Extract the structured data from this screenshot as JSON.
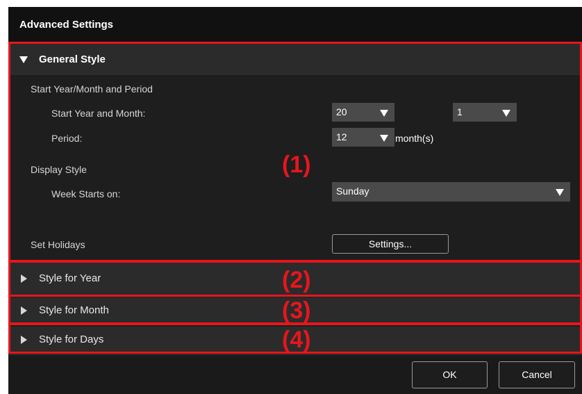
{
  "dialog": {
    "title": "Advanced Settings"
  },
  "general_style": {
    "header": "General Style",
    "start_group_label": "Start Year/Month and Period",
    "start_year_month_label": "Start Year and Month:",
    "start_year_value": "20",
    "start_month_value": "1",
    "period_label": "Period:",
    "period_value": "12",
    "period_unit": "month(s)",
    "display_style_label": "Display Style",
    "week_starts_label": "Week Starts on:",
    "week_starts_value": "Sunday",
    "set_holidays_label": "Set Holidays",
    "settings_button": "Settings..."
  },
  "sections": {
    "year": "Style for Year",
    "month": "Style for Month",
    "days": "Style for Days"
  },
  "annotations": {
    "label_1": "(1)",
    "label_2": "(2)",
    "label_3": "(3)",
    "label_4": "(4)"
  },
  "footer": {
    "ok_label": "OK",
    "cancel_label": "Cancel"
  },
  "colors": {
    "annotation_red": "#e8151c",
    "dialog_background": "#1e1e1e",
    "header_background": "#2b2b2b"
  },
  "icons": [
    "expanded-triangle-icon",
    "collapsed-triangle-icon",
    "dropdown-arrow-icon"
  ]
}
